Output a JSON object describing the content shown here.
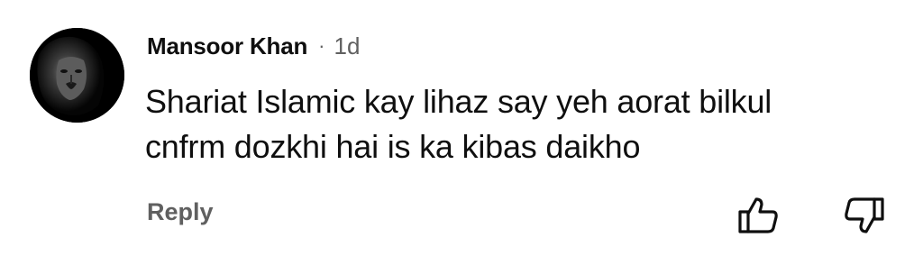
{
  "comment": {
    "author": "Mansoor Khan",
    "separator": "·",
    "time": "1d",
    "text_lines": [
      "Shariat Islamic kay lihaz say yeh aorat bilkul",
      "cnfrm dozkhi hai is ka kibas daikho"
    ],
    "reply_label": "Reply"
  },
  "icons": {
    "avatar": "lion-avatar",
    "like": "thumbs-up-icon",
    "dislike": "thumbs-down-icon"
  },
  "colors": {
    "text_primary": "#0f0f0f",
    "text_secondary": "#606060",
    "background": "#ffffff"
  }
}
